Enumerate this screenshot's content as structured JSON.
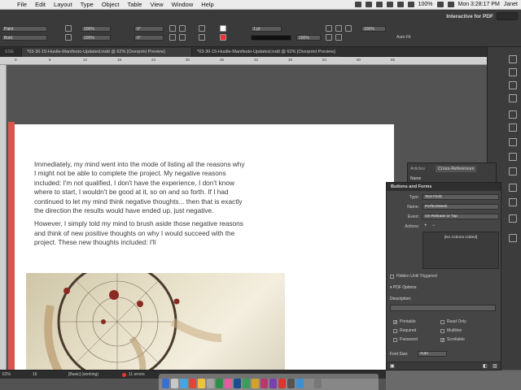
{
  "menubar": {
    "items": [
      "File",
      "Edit",
      "Layout",
      "Type",
      "Object",
      "Table",
      "View",
      "Window",
      "Help"
    ],
    "battery": "100%",
    "clock": "Mon 3:28:17 PM",
    "user": "Janet"
  },
  "control": {
    "fields": [
      "Paint",
      "Bold",
      "100%",
      "100%",
      "0°",
      "0°",
      "1 pt",
      "100%",
      "100%"
    ],
    "workspace": "Interactive for PDF",
    "autofit": "Auto-Fit"
  },
  "tabs": {
    "tab1": "SSE",
    "tab2": "*03-30-15-Hustle-Manifesto-Updated.indd @ 62% [Overprint Preview]",
    "tab3": "*03-30-15-Hustle-Manifesto-Updated.indd @ 62% [Overprint Preview]"
  },
  "ruler": {
    "ticks": [
      "0",
      "6",
      "12",
      "18",
      "24",
      "30",
      "36",
      "42",
      "48",
      "54",
      "60",
      "66"
    ]
  },
  "body": {
    "p1": "Immediately, my mind went into the mode of listing all the reasons why I might not be able to complete the project. My negative reasons included: I'm not qualified, I don't have the experience, I don't know where to start, I wouldn't be good at it, so on and so forth. If I had continued to let my mind think negative thoughts... then that is exactly the direction the results would have ended up, just negative.",
    "p2": "However, I simply told my mind to brush aside those negative reasons and think of new positive thoughts on why I would succeed with the project. These new thoughts included: I'll"
  },
  "cref": {
    "tab_articles": "Articles",
    "tab_crossrefs": "Cross-References",
    "row_name": "Name"
  },
  "buttons_forms": {
    "title": "Buttons and Forms",
    "type_label": "Type:",
    "type_value": "Text Field",
    "name_label": "Name:",
    "name_value": "PerfectWeek",
    "event_label": "Event:",
    "event_value": "On Release or Tap",
    "actions_label": "Actions:",
    "no_actions": "[No Actions Added]",
    "hidden_until": "Hidden Until Triggered",
    "pdf_options": "PDF Options",
    "description_label": "Description:",
    "printable": "Printable",
    "read_only": "Read Only",
    "required": "Required",
    "multiline": "Multiline",
    "password": "Password",
    "scrollable": "Scrollable",
    "font_size_label": "Font Size:",
    "font_size_value": "Auto"
  },
  "status": {
    "zoom": "62%",
    "page": "16",
    "style": "[Basic] (working)",
    "errors": "11 errors"
  }
}
